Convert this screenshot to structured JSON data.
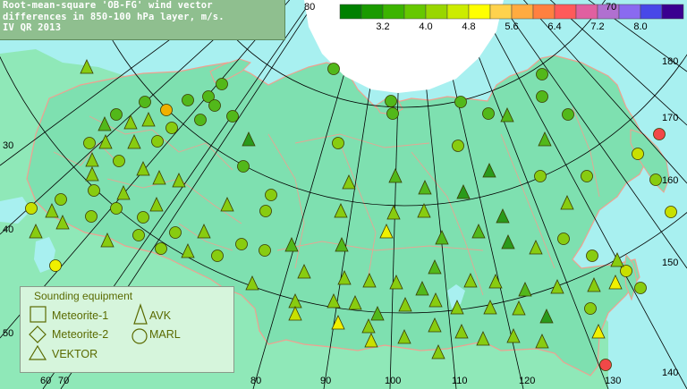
{
  "title": {
    "line1": "Root-mean-square 'OB-FG' wind vector",
    "line2": "differences in 850-100 hPa layer, m/s.",
    "line3": "IV QR 2013"
  },
  "colorbar": {
    "colors": [
      "#008000",
      "#1a9a00",
      "#3cb400",
      "#66c800",
      "#99d600",
      "#ccec00",
      "#ffff00",
      "#ffd24d",
      "#ffab40",
      "#ff8040",
      "#ff5a5a",
      "#e060a0",
      "#b070d0",
      "#8a6af0",
      "#4848e8",
      "#3a0090"
    ],
    "labels": [
      "3.2",
      "4.0",
      "4.8",
      "5.6",
      "6.4",
      "7.2",
      "8.0"
    ]
  },
  "graticule": {
    "lon_labels": [
      "30",
      "40",
      "50",
      "60",
      "70",
      "80",
      "90",
      "100",
      "110",
      "120",
      "130",
      "140",
      "150",
      "160",
      "170",
      "180"
    ],
    "lat_labels": [
      "80",
      "70"
    ]
  },
  "legend": {
    "title": "Sounding equipment",
    "items": [
      "Meteorite-1",
      "Meteorite-2",
      "VEKTOR",
      "AVK",
      "MARL"
    ]
  },
  "colors": {
    "sea": "#a8f0f0",
    "land": "#7ee0b0",
    "border": "#f0a090",
    "grid": "#000000",
    "title_bg": "#8fbf8f"
  }
}
